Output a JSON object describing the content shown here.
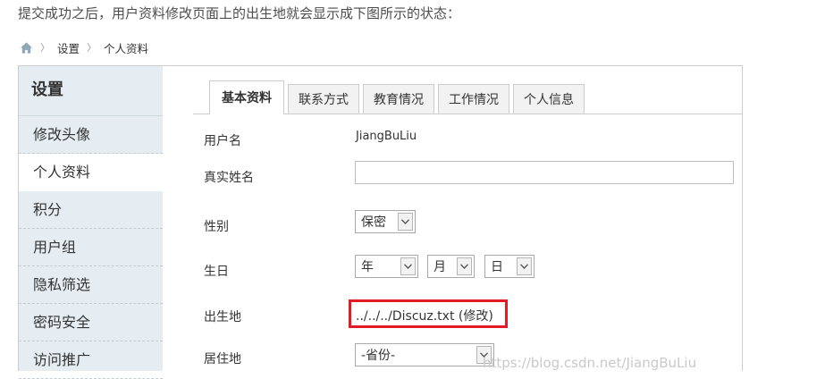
{
  "intro": "提交成功之后，用户资料修改页面上的出生地就会显示成下图所示的状态：",
  "breadcrumb": {
    "home_icon": "home-icon",
    "separator": "〉",
    "items": [
      "设置",
      "个人资料"
    ]
  },
  "sidebar": {
    "title": "设置",
    "items": [
      {
        "label": "修改头像"
      },
      {
        "label": "个人资料"
      },
      {
        "label": "积分"
      },
      {
        "label": "用户组"
      },
      {
        "label": "隐私筛选"
      },
      {
        "label": "密码安全"
      },
      {
        "label": "访问推广"
      }
    ]
  },
  "tabs": [
    "基本资料",
    "联系方式",
    "教育情况",
    "工作情况",
    "个人信息"
  ],
  "form": {
    "username": {
      "label": "用户名",
      "value": "JiangBuLiu"
    },
    "realname": {
      "label": "真实姓名",
      "value": ""
    },
    "gender": {
      "label": "性别",
      "value": "保密"
    },
    "birthday": {
      "label": "生日",
      "year": "年",
      "month": "月",
      "day": "日"
    },
    "birthplace": {
      "label": "出生地",
      "value": "../../../Discuz.txt",
      "edit_link": "(修改)"
    },
    "residence": {
      "label": "居住地",
      "value": "-省份-"
    }
  },
  "watermark": "https://blog.csdn.net/JiangBuLiu",
  "colors": {
    "sidebar_bg": "#e5edf2",
    "highlight": "#e21c25",
    "border": "#cdcdcd"
  }
}
